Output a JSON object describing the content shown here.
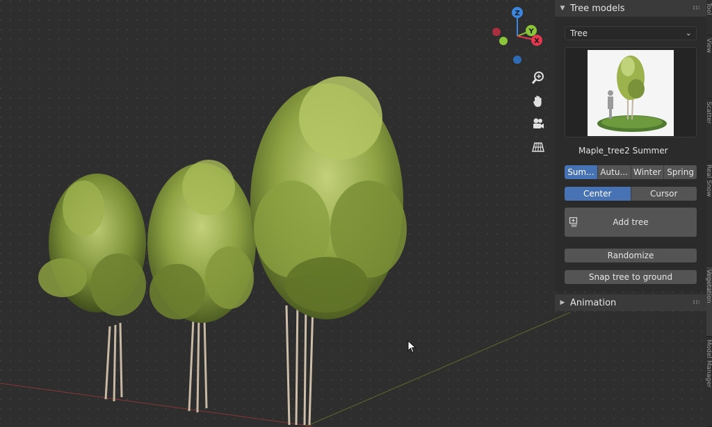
{
  "window": {
    "width": 1024,
    "height": 614
  },
  "gizmo": {
    "z_label": "Z",
    "y_label": "Y",
    "x_label": "X",
    "colors": {
      "x": "#e5384f",
      "y": "#8bc53a",
      "z": "#3b86e0"
    }
  },
  "viewport_tools": [
    {
      "name": "zoom-icon"
    },
    {
      "name": "hand-pan-icon"
    },
    {
      "name": "camera-icon"
    },
    {
      "name": "grid-view-icon"
    }
  ],
  "tree_panel": {
    "title": "Tree models",
    "category_select": "Tree",
    "model_name": "Maple_tree2 Summer",
    "seasons": [
      "Sum...",
      "Autu...",
      "Winter",
      "Spring"
    ],
    "active_season": 0,
    "placement": [
      "Center",
      "Cursor"
    ],
    "active_placement": 0,
    "add_tree_label": "Add tree",
    "randomize_label": "Randomize",
    "snap_label": "Snap tree to ground"
  },
  "animation_panel": {
    "title": "Animation"
  },
  "side_tabs": [
    "Tool",
    "View",
    "Scatter",
    "Real Snow",
    "Vegetation",
    "Model Manager"
  ],
  "colors": {
    "accent": "#4772b3",
    "button": "#545454",
    "panel": "#2b2b2b",
    "header": "#3a3a3a"
  }
}
